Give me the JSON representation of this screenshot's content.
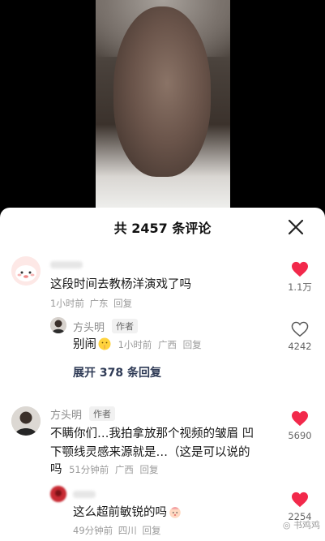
{
  "header": {
    "title": "共 2457 条评论"
  },
  "comments": [
    {
      "user": "",
      "text": "这段时间去教杨洋演戏了吗",
      "time": "1小时前",
      "location": "广东",
      "reply_label": "回复",
      "likes": "1.1万",
      "liked": true,
      "replies": [
        {
          "user": "方头明",
          "tag": "作者",
          "text": "别闹",
          "time": "1小时前",
          "location": "广西",
          "reply_label": "回复",
          "likes": "4242",
          "liked": false
        }
      ],
      "expand_label": "展开 378 条回复"
    },
    {
      "user": "方头明",
      "tag": "作者",
      "text_lines": [
        "不瞒你们…我拍拿放那个视频的皱眉 凹",
        "下颚线灵感来源就是…（这是可以说的",
        "吗"
      ],
      "time": "51分钟前",
      "location": "广西",
      "reply_label": "回复",
      "likes": "5690",
      "liked": true,
      "replies": [
        {
          "user": "",
          "text": "这么超前敏锐的吗",
          "time": "49分钟前",
          "location": "四川",
          "reply_label": "回复",
          "likes": "2254",
          "liked": true
        }
      ]
    }
  ],
  "watermark": "书鸡鸡",
  "colors": {
    "like_red": "#f2294b",
    "expand_text": "#2f3b56"
  }
}
